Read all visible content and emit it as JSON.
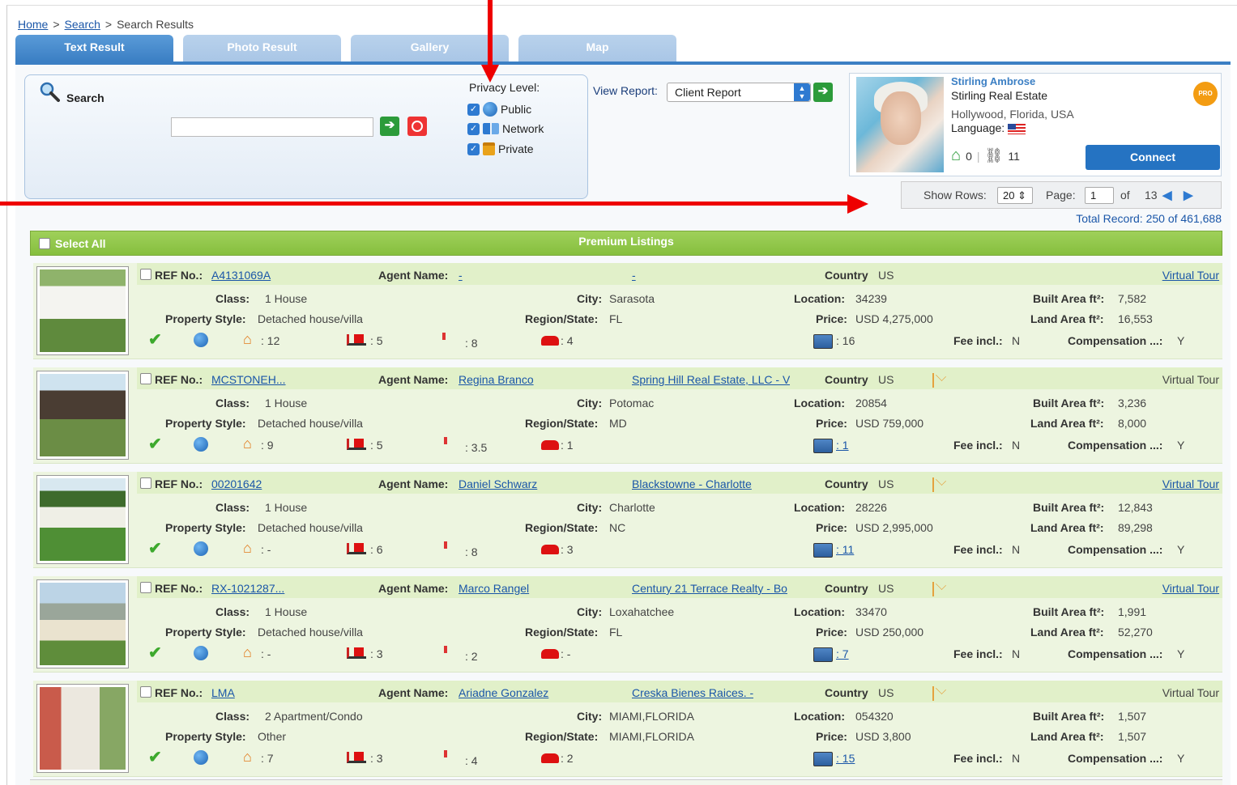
{
  "breadcrumb": {
    "home": "Home",
    "search": "Search",
    "current": "Search Results",
    "sep": ">"
  },
  "tabs": [
    {
      "label": "Text Result",
      "active": true
    },
    {
      "label": "Photo Result",
      "active": false
    },
    {
      "label": "Gallery",
      "active": false
    },
    {
      "label": "Map",
      "active": false
    }
  ],
  "search": {
    "label": "Search",
    "value": ""
  },
  "privacy": {
    "title": "Privacy Level:",
    "options": [
      {
        "label": "Public",
        "checked": true
      },
      {
        "label": "Network",
        "checked": true
      },
      {
        "label": "Private",
        "checked": true
      }
    ]
  },
  "report": {
    "label": "View Report:",
    "selected": "Client Report"
  },
  "agent": {
    "name": "Stirling Ambrose",
    "company": "Stirling Real Estate",
    "location": "Hollywood, Florida, USA",
    "language_label": "Language:",
    "homes": "0",
    "links": "11",
    "badge": "PRO",
    "connect_label": "Connect"
  },
  "pager": {
    "show_rows_label": "Show Rows:",
    "rows": "20",
    "page_label": "Page:",
    "page": "1",
    "of_label": "of",
    "total_pages": "13",
    "total_record": "Total Record: 250 of 461,688"
  },
  "listings_header": {
    "select_all": "Select All",
    "title": "Premium Listings"
  },
  "labels": {
    "ref": "REF No.:",
    "agent": "Agent Name:",
    "country": "Country",
    "class": "Class:",
    "property_style": "Property Style:",
    "city": "City:",
    "region": "Region/State:",
    "location": "Location:",
    "price": "Price:",
    "built": "Built Area ft²:",
    "land": "Land Area ft²:",
    "fee": "Fee incl.:",
    "comp": "Compensation ...:",
    "virtual_tour": "Virtual Tour"
  },
  "listings": [
    {
      "ref": "A4131069A",
      "agent": "-",
      "office": "-",
      "country": "US",
      "class": "1 House",
      "style": "Detached house/villa",
      "city": "Sarasota",
      "region": "FL",
      "location": "34239",
      "price": "USD 4,275,000",
      "built": "7,582",
      "land": "16,553",
      "rooms": ": 12",
      "beds": ": 5",
      "baths": ": 8",
      "cars": ": 4",
      "photos": ": 16",
      "fee": "N",
      "comp": "Y",
      "mail": false,
      "tour_link": true
    },
    {
      "ref": "MCSTONEH...",
      "agent": "Regina Branco",
      "office": "Spring Hill Real Estate, LLC - V",
      "country": "US",
      "class": "1 House",
      "style": "Detached house/villa",
      "city": "Potomac",
      "region": "MD",
      "location": "20854",
      "price": "USD 759,000",
      "built": "3,236",
      "land": "8,000",
      "rooms": ": 9",
      "beds": ": 5",
      "baths": ": 3.5",
      "cars": ": 1",
      "photos": ": 1",
      "fee": "N",
      "comp": "Y",
      "mail": true,
      "tour_link": false
    },
    {
      "ref": "00201642",
      "agent": "Daniel Schwarz",
      "office": "Blackstowne - Charlotte",
      "country": "US",
      "class": "1 House",
      "style": "Detached house/villa",
      "city": "Charlotte",
      "region": "NC",
      "location": "28226",
      "price": "USD 2,995,000",
      "built": "12,843",
      "land": "89,298",
      "rooms": ": -",
      "beds": ": 6",
      "baths": ": 8",
      "cars": ": 3",
      "photos": ": 11",
      "fee": "N",
      "comp": "Y",
      "mail": true,
      "tour_link": true
    },
    {
      "ref": "RX-1021287...",
      "agent": "Marco Rangel",
      "office": "Century 21 Terrace Realty - Bo",
      "country": "US",
      "class": "1 House",
      "style": "Detached house/villa",
      "city": "Loxahatchee",
      "region": "FL",
      "location": "33470",
      "price": "USD 250,000",
      "built": "1,991",
      "land": "52,270",
      "rooms": ": -",
      "beds": ": 3",
      "baths": ": 2",
      "cars": ": -",
      "photos": ": 7",
      "fee": "N",
      "comp": "Y",
      "mail": true,
      "tour_link": true
    },
    {
      "ref": "LMA",
      "agent": "Ariadne Gonzalez",
      "office": "Creska Bienes Raices. -",
      "country": "US",
      "class": "2 Apartment/Condo",
      "style": "Other",
      "city": "MIAMI,FLORIDA",
      "region": "MIAMI,FLORIDA",
      "location": "054320",
      "price": "USD 3,800",
      "built": "1,507",
      "land": "1,507",
      "rooms": ": 7",
      "beds": ": 3",
      "baths": ": 4",
      "cars": ": 2",
      "photos": ": 15",
      "fee": "N",
      "comp": "Y",
      "mail": true,
      "tour_link": false
    }
  ],
  "colors": {
    "accent": "#3b7fc4",
    "green_header": "#8bc34a",
    "annotation": "#e00000"
  }
}
